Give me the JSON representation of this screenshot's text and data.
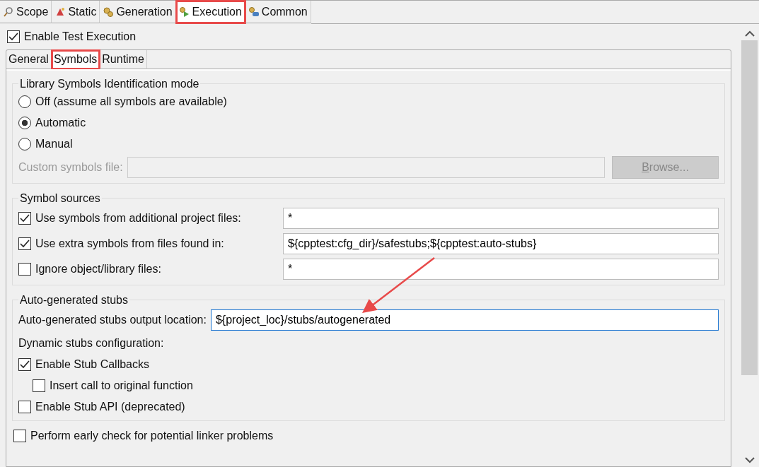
{
  "tabs": [
    {
      "label": "Scope",
      "selected": false,
      "highlighted": false
    },
    {
      "label": "Static",
      "selected": false,
      "highlighted": false
    },
    {
      "label": "Generation",
      "selected": false,
      "highlighted": false
    },
    {
      "label": "Execution",
      "selected": true,
      "highlighted": true
    },
    {
      "label": "Common",
      "selected": false,
      "highlighted": false
    }
  ],
  "enable_test_execution": {
    "label": "Enable Test Execution",
    "checked": true
  },
  "subtabs": [
    {
      "label": "General",
      "selected": false,
      "highlighted": false
    },
    {
      "label": "Symbols",
      "selected": true,
      "highlighted": true
    },
    {
      "label": "Runtime",
      "selected": false,
      "highlighted": false
    }
  ],
  "library_mode": {
    "title": "Library Symbols Identification mode",
    "options": [
      {
        "label": "Off (assume all symbols are available)",
        "selected": false
      },
      {
        "label": "Automatic",
        "selected": true
      },
      {
        "label": "Manual",
        "selected": false
      }
    ],
    "custom_file": {
      "label": "Custom symbols file:",
      "disabled": true
    },
    "browse_button": {
      "label": "Browse...",
      "disabled": true
    }
  },
  "symbol_sources": {
    "title": "Symbol sources",
    "rows": [
      {
        "label": "Use symbols from additional project files:",
        "checked": true,
        "value": "*"
      },
      {
        "label": "Use extra symbols from files found in:",
        "checked": true,
        "value": "${cpptest:cfg_dir}/safestubs;${cpptest:auto-stubs}"
      },
      {
        "label": "Ignore object/library files:",
        "checked": false,
        "value": "*"
      }
    ]
  },
  "stubs": {
    "title": "Auto-generated stubs",
    "output_location": {
      "label": "Auto-generated stubs output location:",
      "value": "${project_loc}/stubs/autogenerated",
      "focused": true
    },
    "dynamic_label": "Dynamic stubs configuration:",
    "options": [
      {
        "label": "Enable Stub Callbacks",
        "checked": true,
        "children": [
          {
            "label": "Insert call to original function",
            "checked": false
          }
        ]
      },
      {
        "label": "Enable Stub API (deprecated)",
        "checked": false
      }
    ]
  },
  "early_check": {
    "label": "Perform early check for potential linker problems",
    "checked": false
  }
}
